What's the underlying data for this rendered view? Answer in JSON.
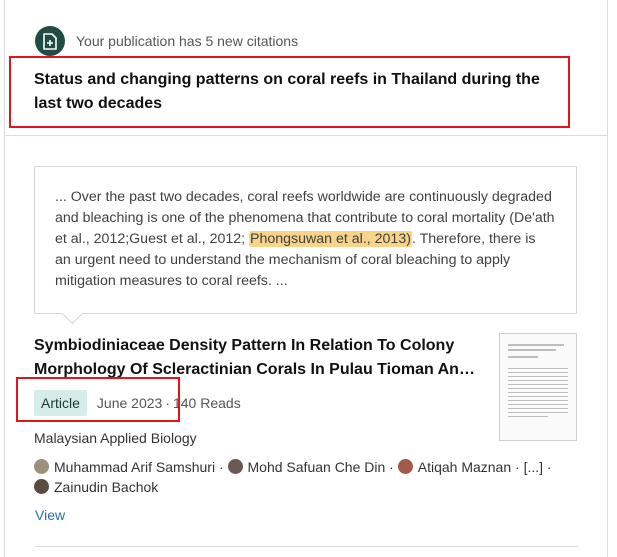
{
  "notification": {
    "text": "Your publication has 5 new citations",
    "icon": "document-add-icon",
    "icon_bg": "#1f4d45"
  },
  "publication": {
    "title": "Status and changing patterns on coral reefs in Thailand during the last two decades"
  },
  "quote": {
    "before": "... Over the past two decades, coral reefs worldwide are continuously degraded and bleaching is one of the phenomena that contribute to coral mortality (De'ath et al., 2012;Guest et al., 2012; ",
    "highlight": "Phongsuwan et al., 2013)",
    "after": ". Therefore, there is an urgent need to understand the mechanism of coral bleaching to apply mitigation measures to coral reefs. ...",
    "highlight_color": "#f8d38a"
  },
  "citing_article": {
    "title": "Symbiodiniaceae Density Pattern In Relation To Colony Morphology Of Scleractinian Corals In Pulau Tioman An…",
    "type_badge": "Article",
    "date": "June 2023",
    "separator": "·",
    "reads": "140 Reads",
    "journal": "Malaysian Applied Biology",
    "authors": [
      {
        "name": "Muhammad Arif Samshuri",
        "sep": " · "
      },
      {
        "name": "Mohd Safuan Che Din",
        "sep": " · "
      },
      {
        "name": "Atiqah Maznan",
        "sep": " · "
      },
      {
        "name": "[...]",
        "sep": " · "
      },
      {
        "name": "Zainudin Bachok",
        "sep": ""
      }
    ],
    "view_label": "View"
  },
  "colors": {
    "highlight_box": "#e0141e",
    "badge_bg": "#d6ece9",
    "link": "#2b6cb0"
  }
}
